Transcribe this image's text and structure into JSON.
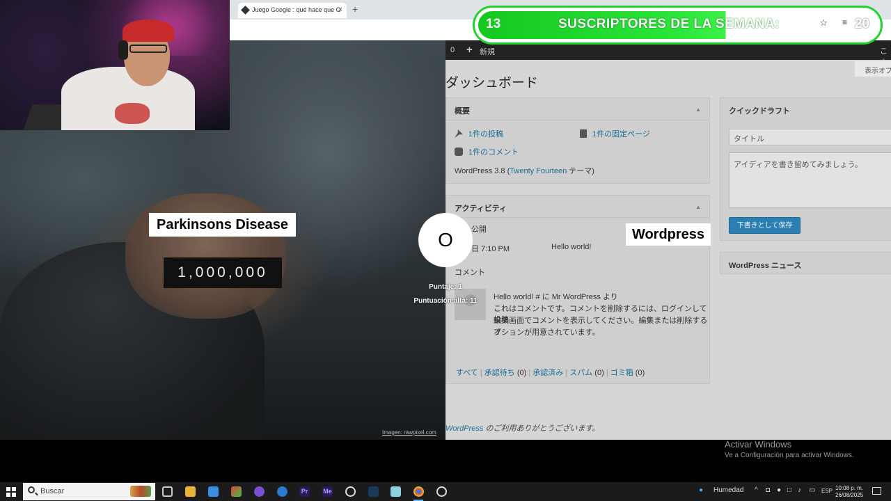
{
  "browser": {
    "tab_title": "Juego Google : qué hace que G",
    "tab_close": "×",
    "new_tab": "+"
  },
  "game": {
    "left_label": "Parkinsons Disease",
    "left_value": "1,000,000",
    "right_label": "Wordpress",
    "vs": "O",
    "score_label": "Puntaje: 1",
    "high_score_label": "Puntuación alta: 11",
    "image_credit": "Imagen: rawpixel.com"
  },
  "wordpress": {
    "adminbar_count": "0",
    "adminbar_new": "新規",
    "adminbar_right": "こん",
    "screen_options": "表示オプ",
    "page_title": "ダッシュボード",
    "overview": {
      "title": "概要",
      "posts": "1件の投稿",
      "pages": "1件の固定ページ",
      "comments": "1件のコメント",
      "version_prefix": "WordPress 3.8 (",
      "theme": "Twenty Fourteen",
      "version_suffix": " テーマ)"
    },
    "activity": {
      "title": "アクティビティ",
      "published_heading": "公開",
      "published_time": "日 7:10 PM",
      "published_post": "Hello world!",
      "comments_heading": "コメント",
      "comment_link": "Hello world! # に Mr WordPress より",
      "comment_body_1": "これはコメントです。コメントを削除するには、ログインして投稿",
      "comment_body_2": "編集画面でコメントを表示してください。編集または削除するオ",
      "comment_body_3": "プションが用意されています。",
      "filters": [
        {
          "label": "すべて",
          "count": ""
        },
        {
          "label": "承認待ち",
          "count": " (0)"
        },
        {
          "label": "承認済み",
          "count": ""
        },
        {
          "label": "スパム",
          "count": " (0)"
        },
        {
          "label": "ゴミ箱",
          "count": " (0)"
        }
      ]
    },
    "quickdraft": {
      "title": "クイックドラフト",
      "title_placeholder": "タイトル",
      "content_placeholder": "アイディアを書き留めてみましょう。",
      "save_button": "下書きとして保存"
    },
    "news": {
      "title": "WordPress ニュース"
    },
    "footer_link": "WordPress",
    "footer_text": " のご利用ありがとうございます。"
  },
  "banner": {
    "left_number": "13",
    "text": "SUSCRIPTORES DE LA SEMANA:",
    "right_number": "20"
  },
  "windows": {
    "activate_title": "Activar Windows",
    "activate_sub": "Ve a Configuración para activar Windows."
  },
  "taskbar": {
    "search_placeholder": "Buscar",
    "weather": "Humedad",
    "language": "ESP",
    "time": "10:08 p. m.",
    "date": "26/08/2025"
  },
  "colors": {
    "wp_link": "#1a6c97",
    "wp_button": "#2b7fb2",
    "banner_green": "#1fd42a",
    "taskbar": "#1b1b1b"
  }
}
